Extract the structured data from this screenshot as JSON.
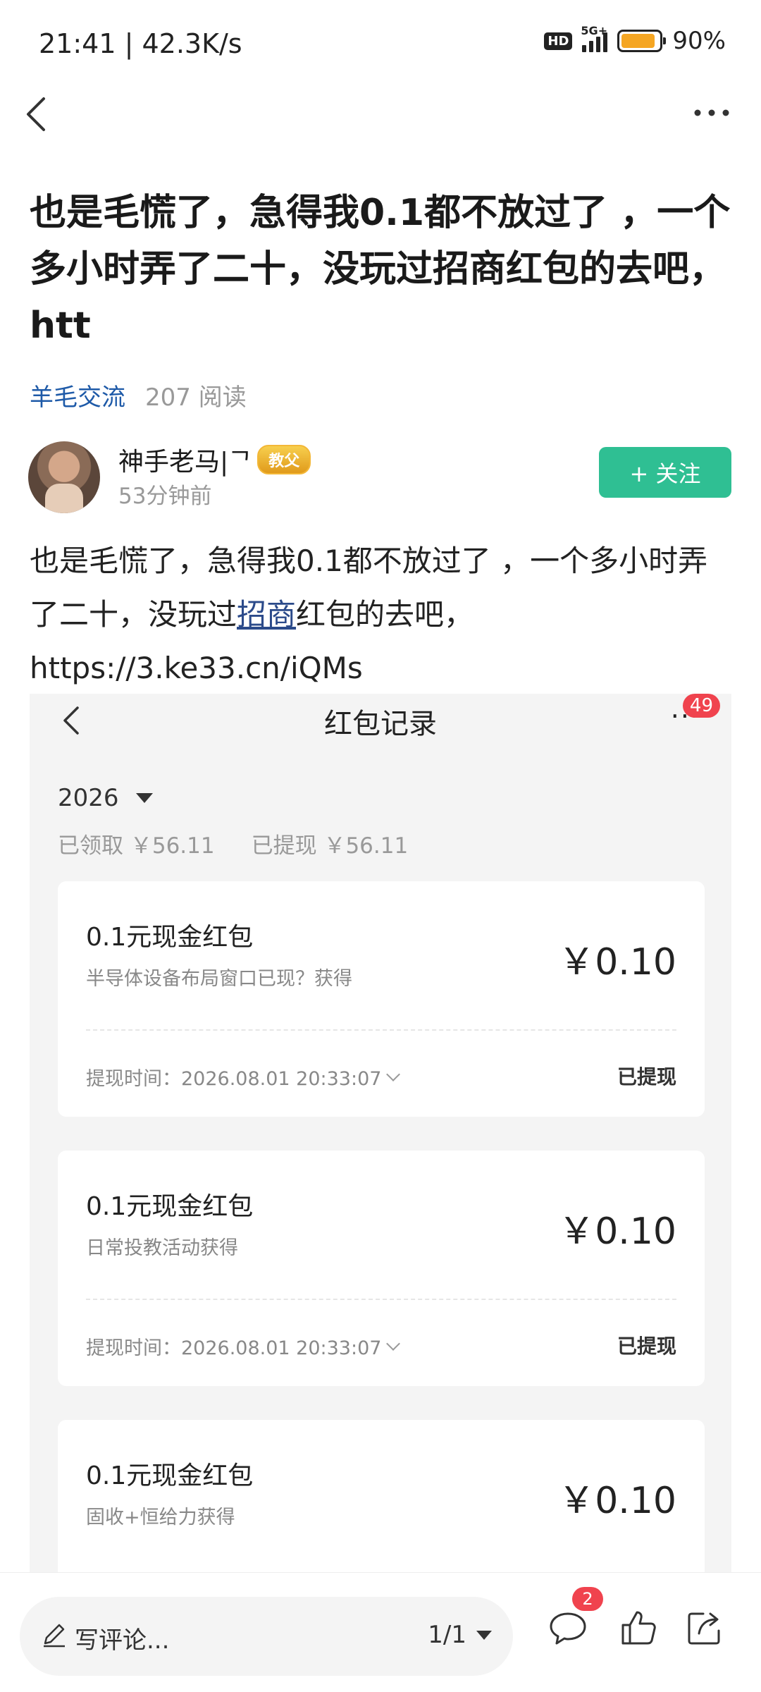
{
  "status_bar": {
    "time_speed": "21:41 | 42.3K/s",
    "hd": "HD",
    "network": "5G+",
    "battery": "90%",
    "battery_level": 0.9
  },
  "nav": {
    "back_icon": "back-arrow-icon",
    "more_icon": "more-dots-icon"
  },
  "post": {
    "title": "也是毛慌了，急得我0.1都不放过了 ，一个多小时弄了二十，没玩过招商红包的去吧， htt",
    "category": "羊毛交流",
    "reads": "207 阅读",
    "author": {
      "name": "神手老马|ᄀ",
      "badge": "教父",
      "time": "53分钟前"
    },
    "follow_label": "+ 关注",
    "content_before": "也是毛慌了，急得我0.1都不放过了 ，一个多小时弄了二十，没玩过",
    "content_link": "招商",
    "content_after": "红包的去吧，",
    "content_url": "https://3.ke33.cn/iQMs"
  },
  "screenshot": {
    "title": "红包记录",
    "dots": "···",
    "notif_count": "49",
    "year": "2026",
    "received": "已领取 ￥56.11",
    "withdrawn": "已提现 ￥56.11",
    "cards": [
      {
        "title": "0.1元现金红包",
        "sub": "半导体设备布局窗口已现？获得",
        "amount": "￥0.10",
        "time": "提现时间：2026.08.01 20:33:07",
        "status": "已提现"
      },
      {
        "title": "0.1元现金红包",
        "sub": "日常投教活动获得",
        "amount": "￥0.10",
        "time": "提现时间：2026.08.01 20:33:07",
        "status": "已提现"
      },
      {
        "title": "0.1元现金红包",
        "sub": "固收+恒给力获得",
        "amount": "￥0.10",
        "time": "",
        "status": ""
      }
    ]
  },
  "bottom_bar": {
    "comment_placeholder": "写评论...",
    "pager": "1/1",
    "comment_count": "2",
    "icons": [
      "pencil-icon",
      "comment-icon",
      "like-icon",
      "share-icon"
    ]
  }
}
